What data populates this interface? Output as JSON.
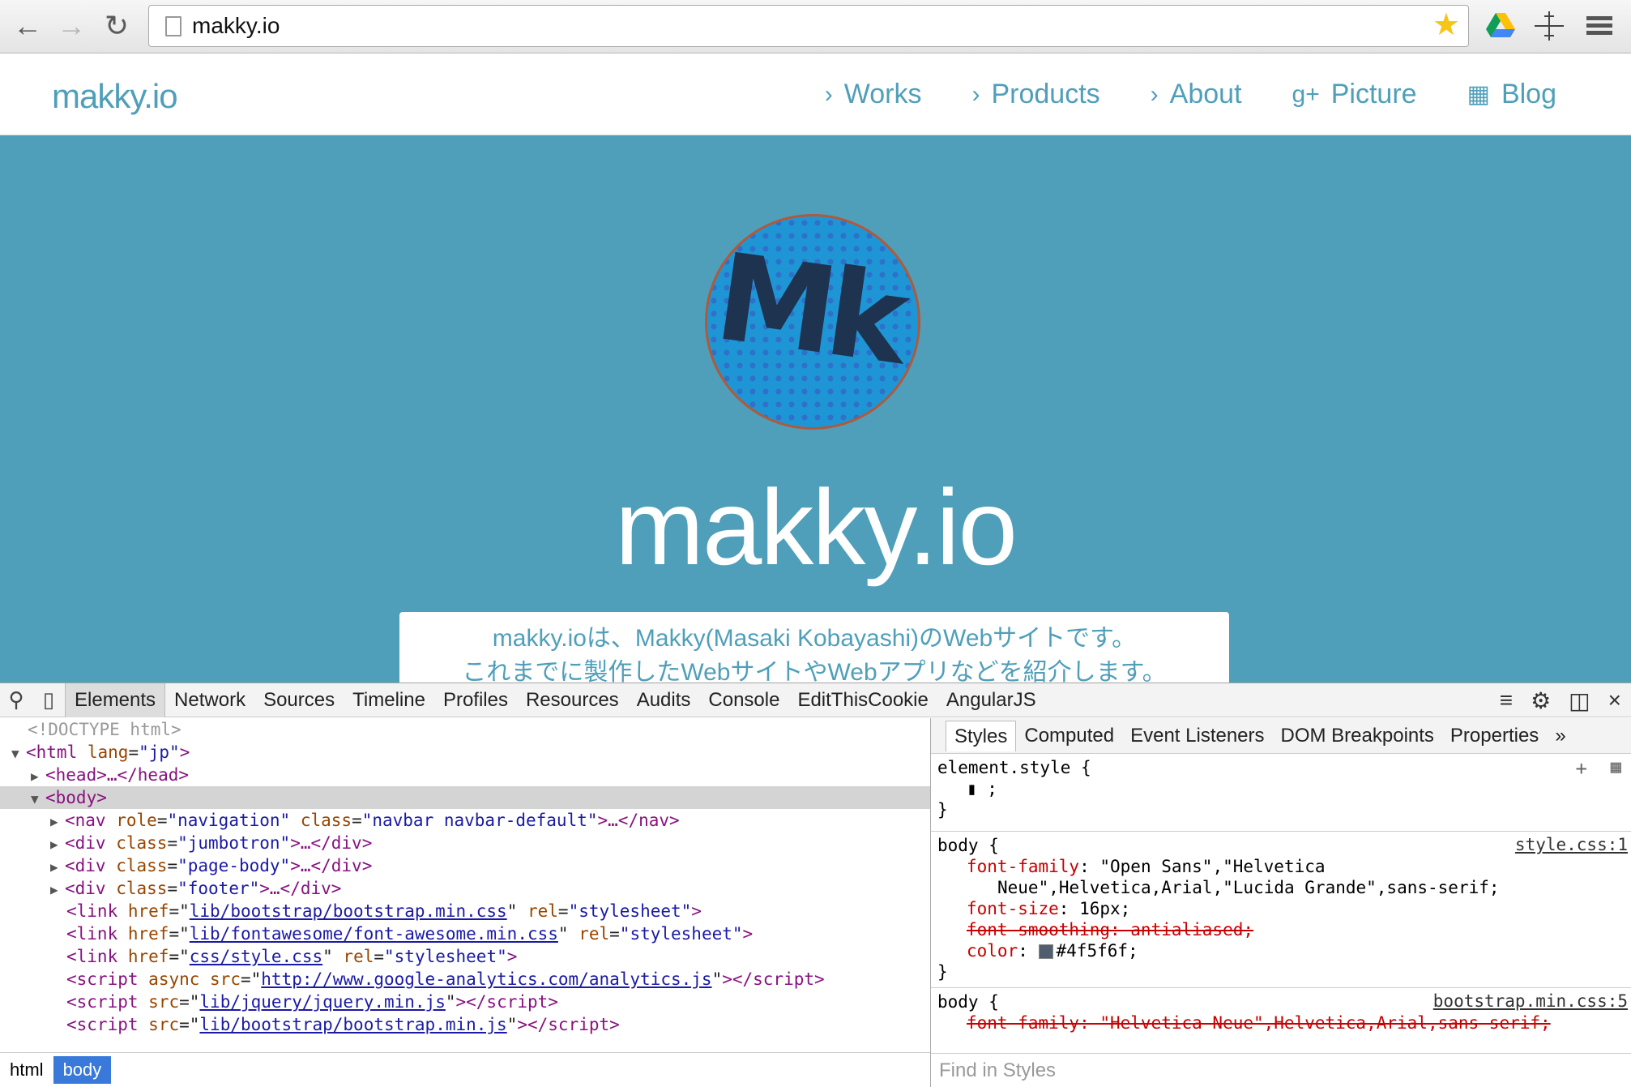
{
  "browser": {
    "url": "makky.io",
    "back_icon": "arrow-left-icon",
    "forward_icon": "arrow-right-icon",
    "reload_icon": "reload-icon"
  },
  "site": {
    "brand": "makky.io",
    "menu": [
      {
        "label": "Works",
        "icon": "chevron-right-icon"
      },
      {
        "label": "Products",
        "icon": "chevron-right-icon"
      },
      {
        "label": "About",
        "icon": "chevron-right-icon"
      },
      {
        "label": "Picture",
        "icon": "google-plus-icon"
      },
      {
        "label": "Blog",
        "icon": "calendar-icon"
      }
    ],
    "hero_title": "makky.io",
    "logo_text": "Mk",
    "intro_line1": "makky.ioは、Makky(Masaki Kobayashi)のWebサイトです。",
    "intro_line2": "これまでに製作したWebサイトやWebアプリなどを紹介します。",
    "accent_color": "#4f9fba"
  },
  "devtools": {
    "tabs": [
      "Elements",
      "Network",
      "Sources",
      "Timeline",
      "Profiles",
      "Resources",
      "Audits",
      "Console",
      "EditThisCookie",
      "AngularJS"
    ],
    "active_tab": "Elements",
    "dom": {
      "doctype": "<!DOCTYPE html>",
      "html_open": "<html",
      "html_lang_attr": "lang",
      "html_lang_val": "\"jp\"",
      "head": "<head>…</head>",
      "body": "<body>",
      "nav_role": "\"navigation\"",
      "nav_class": "\"navbar navbar-default\"",
      "div_jumbotron": "\"jumbotron\"",
      "div_pagebody": "\"page-body\"",
      "div_footer": "\"footer\"",
      "link1": "lib/bootstrap/bootstrap.min.css",
      "link2": "lib/fontawesome/font-awesome.min.css",
      "link3": "css/style.css",
      "script1": "http://www.google-analytics.com/analytics.js",
      "script2": "lib/jquery/jquery.min.js",
      "script3": "lib/bootstrap/bootstrap.min.js"
    },
    "breadcrumbs": [
      "html",
      "body"
    ],
    "styles_tabs": [
      "Styles",
      "Computed",
      "Event Listeners",
      "DOM Breakpoints",
      "Properties"
    ],
    "rules": {
      "element_style": "element.style {",
      "body1_selector": "body {",
      "body1_src": "style.css:1",
      "font_family_prop": "font-family",
      "font_family_val1": "\"Open Sans\",\"Helvetica",
      "font_family_val2": "Neue\",Helvetica,Arial,\"Lucida Grande\",sans-serif;",
      "font_size_prop": "font-size",
      "font_size_val": "16px;",
      "font_smoothing": "font-smoothing: antialiased;",
      "color_prop": "color",
      "color_val": "#4f5f6f;",
      "body2_selector": "body {",
      "body2_src": "bootstrap.min.css:5",
      "body2_font_family": "font-family: \"Helvetica Neue\",Helvetica,Arial,sans-serif;"
    },
    "find_placeholder": "Find in Styles"
  }
}
